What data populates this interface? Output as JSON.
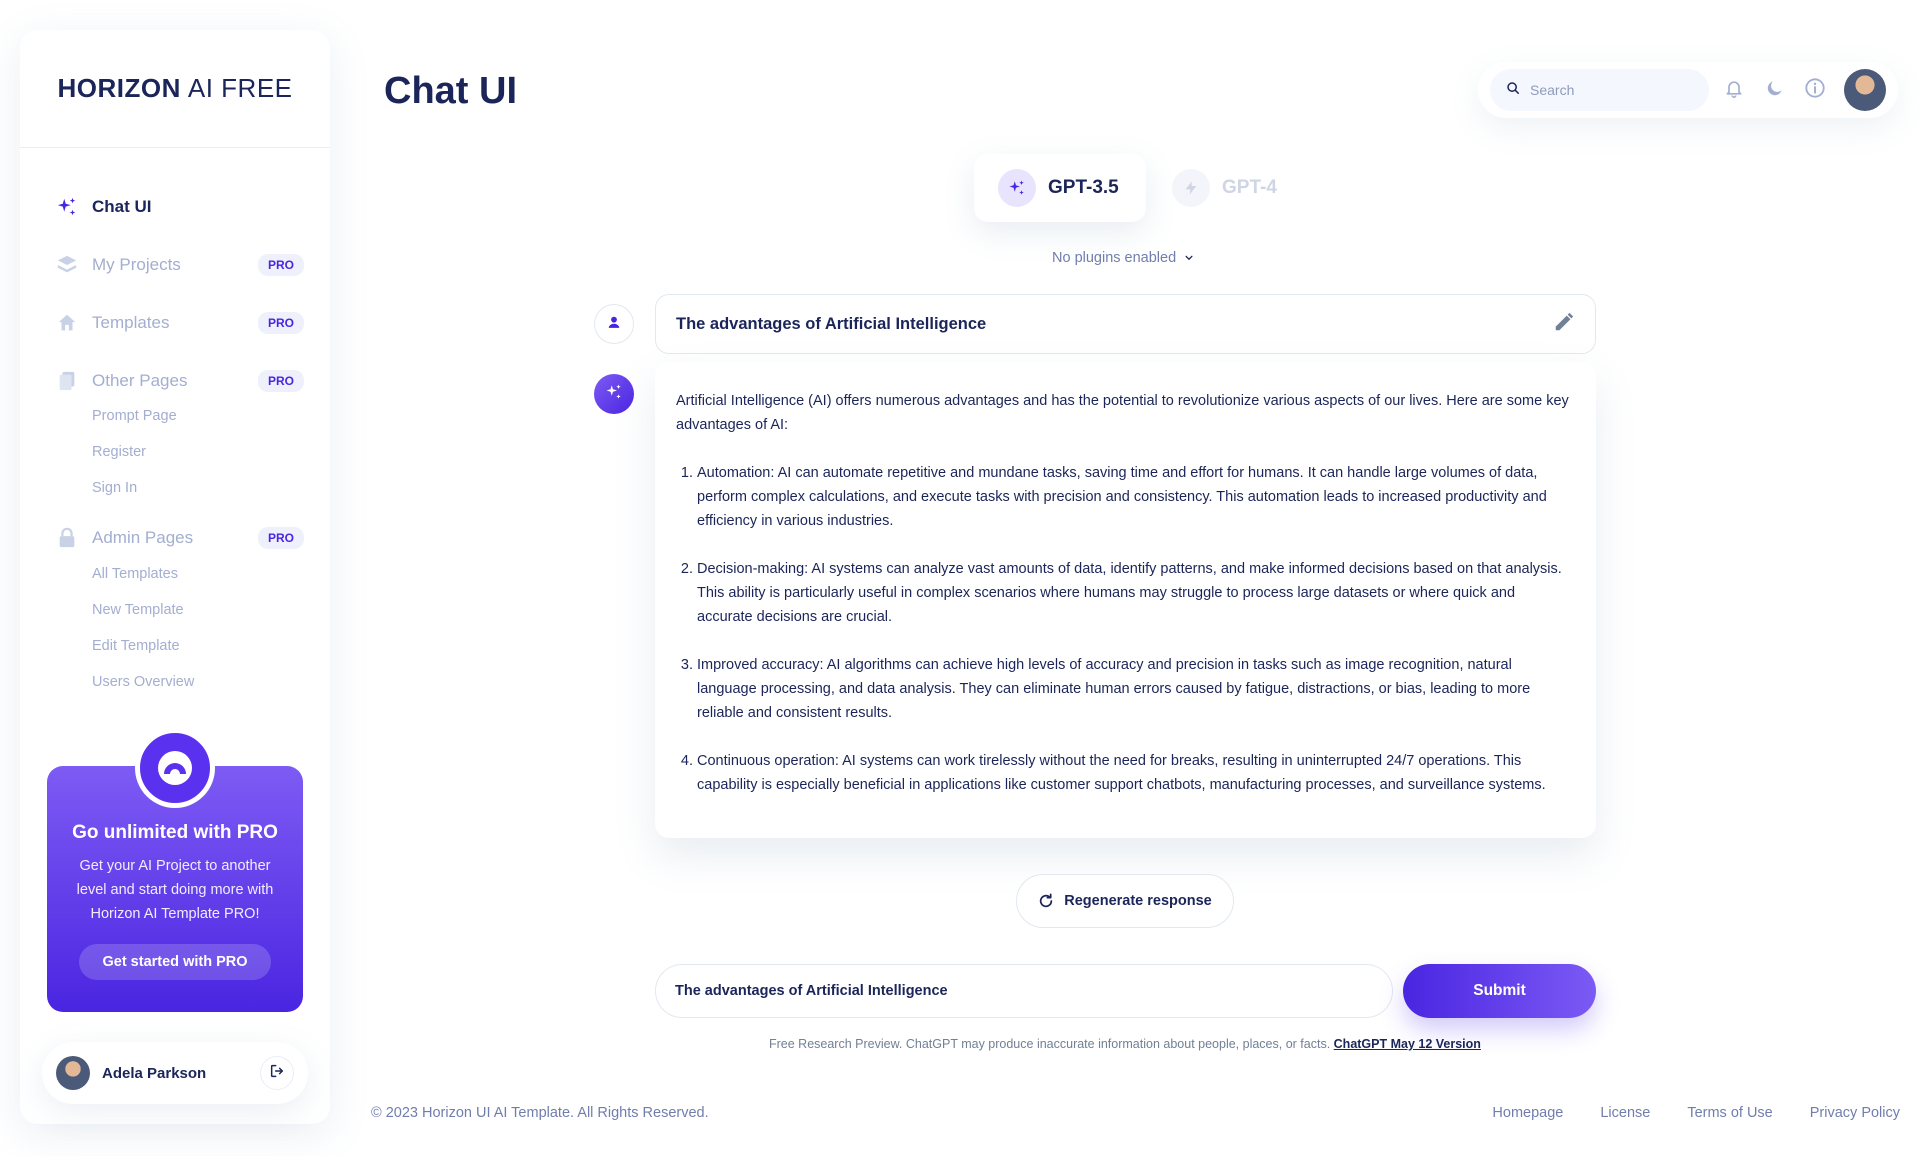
{
  "sidebar": {
    "logo_bold": "HORIZON",
    "logo_light": "AI FREE",
    "items": [
      {
        "label": "Chat UI",
        "icon": "sparkles-icon",
        "active": true
      },
      {
        "label": "My Projects",
        "icon": "layers-icon",
        "badge": "PRO"
      },
      {
        "label": "Templates",
        "icon": "home-icon",
        "badge": "PRO"
      },
      {
        "label": "Other Pages",
        "icon": "documents-icon",
        "badge": "PRO"
      },
      {
        "label": "Admin Pages",
        "icon": "lock-icon",
        "badge": "PRO"
      }
    ],
    "other_pages": [
      "Prompt Page",
      "Register",
      "Sign In"
    ],
    "admin_pages": [
      "All Templates",
      "New Template",
      "Edit Template",
      "Users Overview"
    ],
    "promo": {
      "title": "Go unlimited with PRO",
      "text": "Get your AI Project to another level and start doing more with Horizon AI Template PRO!",
      "button": "Get started with PRO"
    },
    "user": {
      "name": "Adela Parkson"
    }
  },
  "header": {
    "title": "Chat UI",
    "search_placeholder": "Search"
  },
  "models": [
    {
      "label": "GPT-3.5",
      "active": true
    },
    {
      "label": "GPT-4",
      "active": false
    }
  ],
  "plugins_label": "No plugins enabled",
  "chat": {
    "prompt": "The advantages of Artificial Intelligence",
    "response_intro": "Artificial Intelligence (AI) offers numerous advantages and has the potential to revolutionize various aspects of our lives. Here are some key advantages of AI:",
    "response_points": [
      "Automation: AI can automate repetitive and mundane tasks, saving time and effort for humans. It can handle large volumes of data, perform complex calculations, and execute tasks with precision and consistency. This automation leads to increased productivity and efficiency in various industries.",
      "Decision-making: AI systems can analyze vast amounts of data, identify patterns, and make informed decisions based on that analysis. This ability is particularly useful in complex scenarios where humans may struggle to process large datasets or where quick and accurate decisions are crucial.",
      "Improved accuracy: AI algorithms can achieve high levels of accuracy and precision in tasks such as image recognition, natural language processing, and data analysis. They can eliminate human errors caused by fatigue, distractions, or bias, leading to more reliable and consistent results.",
      "Continuous operation: AI systems can work tirelessly without the need for breaks, resulting in uninterrupted 24/7 operations. This capability is especially beneficial in applications like customer support chatbots, manufacturing processes, and surveillance systems."
    ],
    "regenerate_label": "Regenerate response",
    "input_value": "The advantages of Artificial Intelligence",
    "submit_label": "Submit",
    "disclaimer": "Free Research Preview. ChatGPT may produce inaccurate information about people, places, or facts.",
    "version_link": "ChatGPT May 12 Version"
  },
  "footer": {
    "copyright": "© 2023 Horizon UI AI Template. All Rights Reserved.",
    "links": [
      "Homepage",
      "License",
      "Terms of Use",
      "Privacy Policy"
    ]
  },
  "colors": {
    "brand": "#4a25e1",
    "brand_light": "#7e5bf4",
    "navy": "#1b2559",
    "muted": "#a3aed0"
  }
}
